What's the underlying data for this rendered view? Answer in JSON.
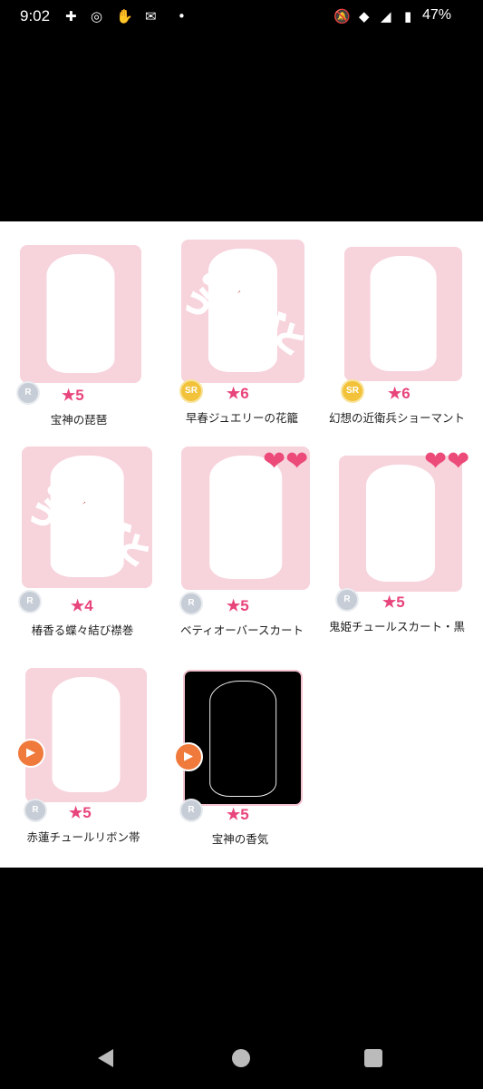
{
  "status_bar": {
    "time": "9:02",
    "battery_percent": "47%",
    "left_icons": [
      "puzzle-icon",
      "instagram-icon",
      "hand-icon",
      "mail-icon",
      "dot-icon"
    ],
    "right_icons": [
      "mute-icon",
      "wifi-icon",
      "signal-icon",
      "battery-icon"
    ]
  },
  "items": [
    {
      "name": "宝神の琵琶",
      "rarity": "R",
      "stars": "★5",
      "stamp": ""
    },
    {
      "name": "早春ジュエリーの花籠",
      "rarity": "SR",
      "stars": "★6",
      "stamp": "ありがとう"
    },
    {
      "name": "幻想の近衛兵ショーマント",
      "rarity": "SR",
      "stars": "★6",
      "stamp": ""
    },
    {
      "name": "椿香る蝶々結び襟巻",
      "rarity": "R",
      "stars": "★4",
      "stamp": "ありがとう"
    },
    {
      "name": "ベティオーバースカート",
      "rarity": "R",
      "stars": "★5",
      "stamp": ""
    },
    {
      "name": "鬼姫チュールスカート・黒",
      "rarity": "R",
      "stars": "★5",
      "stamp": ""
    },
    {
      "name": "赤蓮チュールリボン帯",
      "rarity": "R",
      "stars": "★5",
      "stamp": ""
    },
    {
      "name": "宝神の香気",
      "rarity": "R",
      "stars": "★5",
      "stamp": ""
    }
  ],
  "colors": {
    "panel_bg": "#ffffff",
    "card_bg": "#f7d3dc",
    "star_pink": "#e8457a",
    "stamp_red": "#c01818",
    "play_orange": "#f07a3c"
  }
}
